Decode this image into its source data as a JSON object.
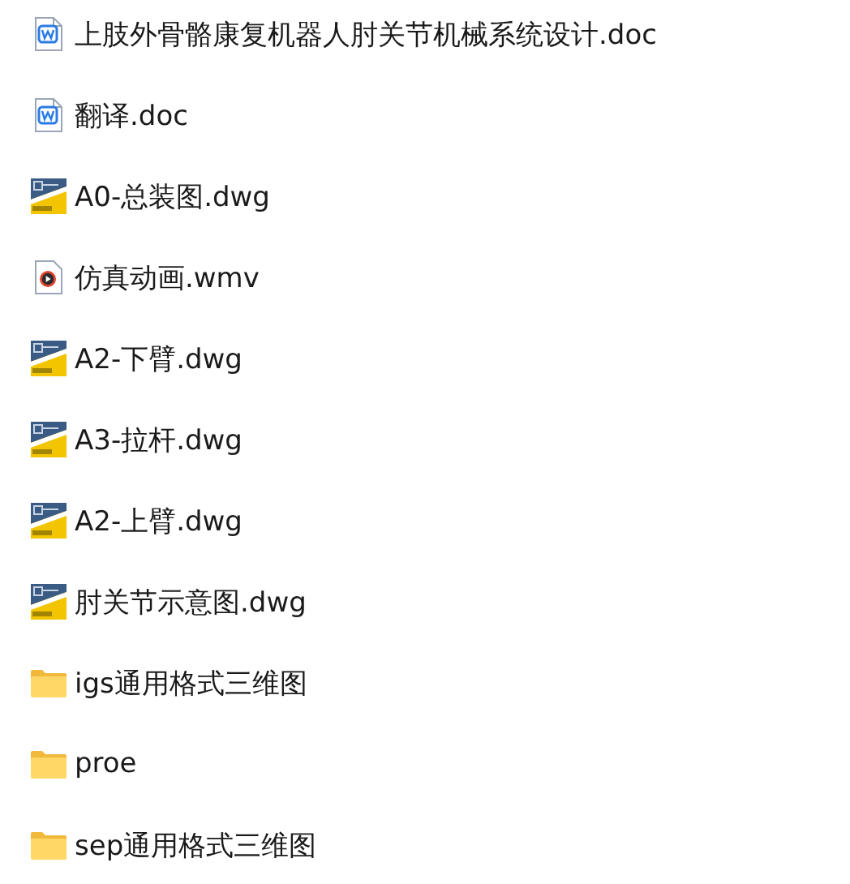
{
  "files": [
    {
      "name": "上肢外骨骼康复机器人肘关节机械系统设计.doc",
      "kind": "word"
    },
    {
      "name": "翻译.doc",
      "kind": "word"
    },
    {
      "name": "A0-总装图.dwg",
      "kind": "dwg"
    },
    {
      "name": "仿真动画.wmv",
      "kind": "video"
    },
    {
      "name": "A2-下臂.dwg",
      "kind": "dwg"
    },
    {
      "name": "A3-拉杆.dwg",
      "kind": "dwg"
    },
    {
      "name": "A2-上臂.dwg",
      "kind": "dwg"
    },
    {
      "name": "肘关节示意图.dwg",
      "kind": "dwg"
    },
    {
      "name": "igs通用格式三维图",
      "kind": "folder"
    },
    {
      "name": "proe",
      "kind": "folder"
    },
    {
      "name": "sep通用格式三维图",
      "kind": "folder"
    }
  ]
}
